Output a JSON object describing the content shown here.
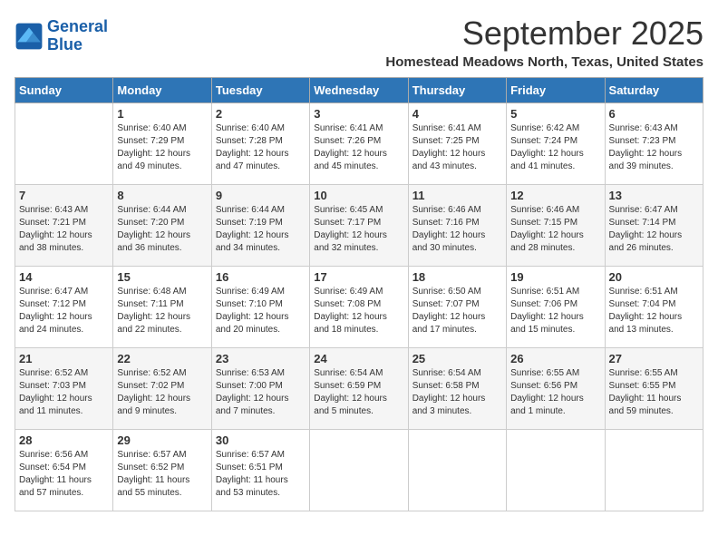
{
  "app": {
    "logo_line1": "General",
    "logo_line2": "Blue"
  },
  "header": {
    "month": "September 2025",
    "location": "Homestead Meadows North, Texas, United States"
  },
  "weekdays": [
    "Sunday",
    "Monday",
    "Tuesday",
    "Wednesday",
    "Thursday",
    "Friday",
    "Saturday"
  ],
  "weeks": [
    [
      {
        "day": "",
        "info": ""
      },
      {
        "day": "1",
        "info": "Sunrise: 6:40 AM\nSunset: 7:29 PM\nDaylight: 12 hours\nand 49 minutes."
      },
      {
        "day": "2",
        "info": "Sunrise: 6:40 AM\nSunset: 7:28 PM\nDaylight: 12 hours\nand 47 minutes."
      },
      {
        "day": "3",
        "info": "Sunrise: 6:41 AM\nSunset: 7:26 PM\nDaylight: 12 hours\nand 45 minutes."
      },
      {
        "day": "4",
        "info": "Sunrise: 6:41 AM\nSunset: 7:25 PM\nDaylight: 12 hours\nand 43 minutes."
      },
      {
        "day": "5",
        "info": "Sunrise: 6:42 AM\nSunset: 7:24 PM\nDaylight: 12 hours\nand 41 minutes."
      },
      {
        "day": "6",
        "info": "Sunrise: 6:43 AM\nSunset: 7:23 PM\nDaylight: 12 hours\nand 39 minutes."
      }
    ],
    [
      {
        "day": "7",
        "info": "Sunrise: 6:43 AM\nSunset: 7:21 PM\nDaylight: 12 hours\nand 38 minutes."
      },
      {
        "day": "8",
        "info": "Sunrise: 6:44 AM\nSunset: 7:20 PM\nDaylight: 12 hours\nand 36 minutes."
      },
      {
        "day": "9",
        "info": "Sunrise: 6:44 AM\nSunset: 7:19 PM\nDaylight: 12 hours\nand 34 minutes."
      },
      {
        "day": "10",
        "info": "Sunrise: 6:45 AM\nSunset: 7:17 PM\nDaylight: 12 hours\nand 32 minutes."
      },
      {
        "day": "11",
        "info": "Sunrise: 6:46 AM\nSunset: 7:16 PM\nDaylight: 12 hours\nand 30 minutes."
      },
      {
        "day": "12",
        "info": "Sunrise: 6:46 AM\nSunset: 7:15 PM\nDaylight: 12 hours\nand 28 minutes."
      },
      {
        "day": "13",
        "info": "Sunrise: 6:47 AM\nSunset: 7:14 PM\nDaylight: 12 hours\nand 26 minutes."
      }
    ],
    [
      {
        "day": "14",
        "info": "Sunrise: 6:47 AM\nSunset: 7:12 PM\nDaylight: 12 hours\nand 24 minutes."
      },
      {
        "day": "15",
        "info": "Sunrise: 6:48 AM\nSunset: 7:11 PM\nDaylight: 12 hours\nand 22 minutes."
      },
      {
        "day": "16",
        "info": "Sunrise: 6:49 AM\nSunset: 7:10 PM\nDaylight: 12 hours\nand 20 minutes."
      },
      {
        "day": "17",
        "info": "Sunrise: 6:49 AM\nSunset: 7:08 PM\nDaylight: 12 hours\nand 18 minutes."
      },
      {
        "day": "18",
        "info": "Sunrise: 6:50 AM\nSunset: 7:07 PM\nDaylight: 12 hours\nand 17 minutes."
      },
      {
        "day": "19",
        "info": "Sunrise: 6:51 AM\nSunset: 7:06 PM\nDaylight: 12 hours\nand 15 minutes."
      },
      {
        "day": "20",
        "info": "Sunrise: 6:51 AM\nSunset: 7:04 PM\nDaylight: 12 hours\nand 13 minutes."
      }
    ],
    [
      {
        "day": "21",
        "info": "Sunrise: 6:52 AM\nSunset: 7:03 PM\nDaylight: 12 hours\nand 11 minutes."
      },
      {
        "day": "22",
        "info": "Sunrise: 6:52 AM\nSunset: 7:02 PM\nDaylight: 12 hours\nand 9 minutes."
      },
      {
        "day": "23",
        "info": "Sunrise: 6:53 AM\nSunset: 7:00 PM\nDaylight: 12 hours\nand 7 minutes."
      },
      {
        "day": "24",
        "info": "Sunrise: 6:54 AM\nSunset: 6:59 PM\nDaylight: 12 hours\nand 5 minutes."
      },
      {
        "day": "25",
        "info": "Sunrise: 6:54 AM\nSunset: 6:58 PM\nDaylight: 12 hours\nand 3 minutes."
      },
      {
        "day": "26",
        "info": "Sunrise: 6:55 AM\nSunset: 6:56 PM\nDaylight: 12 hours\nand 1 minute."
      },
      {
        "day": "27",
        "info": "Sunrise: 6:55 AM\nSunset: 6:55 PM\nDaylight: 11 hours\nand 59 minutes."
      }
    ],
    [
      {
        "day": "28",
        "info": "Sunrise: 6:56 AM\nSunset: 6:54 PM\nDaylight: 11 hours\nand 57 minutes."
      },
      {
        "day": "29",
        "info": "Sunrise: 6:57 AM\nSunset: 6:52 PM\nDaylight: 11 hours\nand 55 minutes."
      },
      {
        "day": "30",
        "info": "Sunrise: 6:57 AM\nSunset: 6:51 PM\nDaylight: 11 hours\nand 53 minutes."
      },
      {
        "day": "",
        "info": ""
      },
      {
        "day": "",
        "info": ""
      },
      {
        "day": "",
        "info": ""
      },
      {
        "day": "",
        "info": ""
      }
    ]
  ]
}
